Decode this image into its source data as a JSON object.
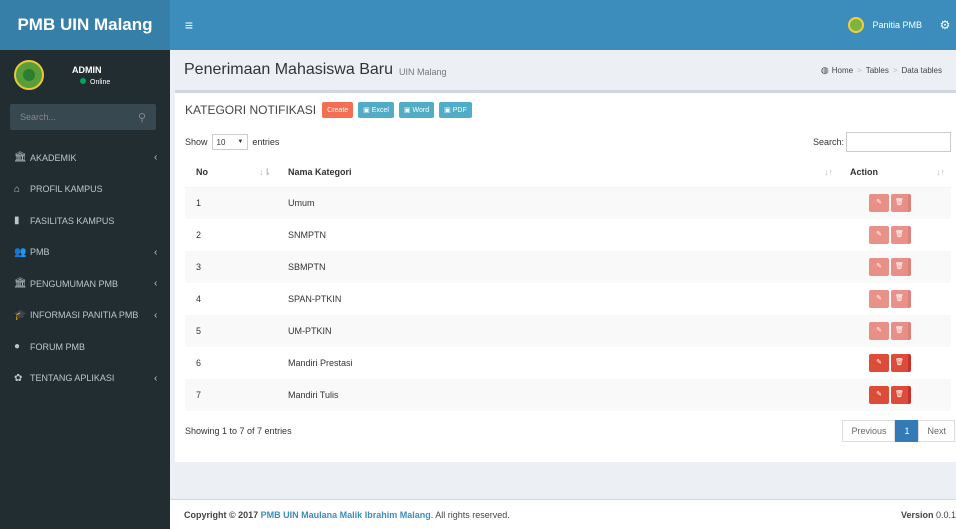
{
  "header": {
    "brand": "PMB UIN Malang",
    "menu_toggle": "≡",
    "user_label": "Panitia PMB",
    "gear": "⚙"
  },
  "sidebar": {
    "user_name": "ADMIN",
    "user_status": "Online",
    "search_placeholder": "Search...",
    "items": [
      {
        "label": "AKADEMIK",
        "icon": "institution-icon",
        "glyph": "🏛",
        "arrow": "‹"
      },
      {
        "label": "PROFIL KAMPUS",
        "icon": "home-icon",
        "glyph": "⌂",
        "arrow": ""
      },
      {
        "label": "FASILITAS KAMPUS",
        "icon": "book-icon",
        "glyph": "▮",
        "arrow": ""
      },
      {
        "label": "PMB",
        "icon": "user-plus-icon",
        "glyph": "👥",
        "arrow": "‹"
      },
      {
        "label": "PENGUMUMAN PMB",
        "icon": "institution-icon",
        "glyph": "🏛",
        "arrow": "‹"
      },
      {
        "label": "INFORMASI PANITIA PMB",
        "icon": "graduation-cap-icon",
        "glyph": "🎓",
        "arrow": "‹"
      },
      {
        "label": "FORUM PMB",
        "icon": "comments-icon",
        "glyph": "●",
        "arrow": ""
      },
      {
        "label": "TENTANG APLIKASI",
        "icon": "cog-icon",
        "glyph": "✿",
        "arrow": "‹"
      }
    ]
  },
  "content": {
    "title": "Penerimaan Mahasiswa Baru",
    "subtitle": "UIN Malang",
    "breadcrumb": [
      "Home",
      "Tables",
      "Data tables"
    ]
  },
  "box": {
    "title": "KATEGORI NOTIFIKASI",
    "buttons": {
      "create": "Create",
      "excel": "Excel",
      "word": "Word",
      "pdf": "PDF"
    }
  },
  "table": {
    "show_label": "Show",
    "entries_value": "10",
    "entries_label": "entries",
    "search_label": "Search:",
    "columns": [
      "No",
      "Nama Kategori",
      "Action"
    ],
    "rows": [
      {
        "no": "1",
        "nama": "Umum"
      },
      {
        "no": "2",
        "nama": "SNMPTN"
      },
      {
        "no": "3",
        "nama": "SBMPTN"
      },
      {
        "no": "4",
        "nama": "SPAN-PTKIN"
      },
      {
        "no": "5",
        "nama": "UM-PTKIN"
      },
      {
        "no": "6",
        "nama": "Mandiri Prestasi"
      },
      {
        "no": "7",
        "nama": "Mandiri Tulis"
      }
    ],
    "info": "Showing 1 to 7 of 7 entries",
    "pagination": {
      "previous": "Previous",
      "current": "1",
      "next": "Next"
    }
  },
  "footer": {
    "copyright_prefix": "Copyright © 2017",
    "org": "PMB UIN Maulana Malik Ibrahim Malang",
    "suffix": ". All rights reserved.",
    "version_label": "Version",
    "version_value": "0.0.1"
  }
}
